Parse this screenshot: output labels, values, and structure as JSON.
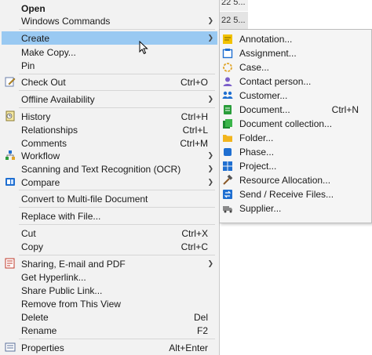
{
  "background": {
    "top_snippet": "22 5...",
    "row_snippet": "22 5..."
  },
  "menu": {
    "items": [
      {
        "label": "Open",
        "shortcut": "",
        "submenu": false
      },
      {
        "label": "Windows Commands",
        "shortcut": "",
        "submenu": true
      },
      {
        "label": "Create",
        "shortcut": "",
        "submenu": true
      },
      {
        "label": "Make Copy...",
        "shortcut": "",
        "submenu": false
      },
      {
        "label": "Pin",
        "shortcut": "",
        "submenu": false
      },
      {
        "label": "Check Out",
        "shortcut": "Ctrl+O",
        "submenu": false
      },
      {
        "label": "Offline Availability",
        "shortcut": "",
        "submenu": true
      },
      {
        "label": "History",
        "shortcut": "Ctrl+H",
        "submenu": false
      },
      {
        "label": "Relationships",
        "shortcut": "Ctrl+L",
        "submenu": false
      },
      {
        "label": "Comments",
        "shortcut": "Ctrl+M",
        "submenu": false
      },
      {
        "label": "Workflow",
        "shortcut": "",
        "submenu": true
      },
      {
        "label": "Scanning and Text Recognition (OCR)",
        "shortcut": "",
        "submenu": true
      },
      {
        "label": "Compare",
        "shortcut": "",
        "submenu": true
      },
      {
        "label": "Convert to Multi-file Document",
        "shortcut": "",
        "submenu": false
      },
      {
        "label": "Replace with File...",
        "shortcut": "",
        "submenu": false
      },
      {
        "label": "Cut",
        "shortcut": "Ctrl+X",
        "submenu": false
      },
      {
        "label": "Copy",
        "shortcut": "Ctrl+C",
        "submenu": false
      },
      {
        "label": "Sharing, E-mail and PDF",
        "shortcut": "",
        "submenu": true
      },
      {
        "label": "Get Hyperlink...",
        "shortcut": "",
        "submenu": false
      },
      {
        "label": "Share Public Link...",
        "shortcut": "",
        "submenu": false
      },
      {
        "label": "Remove from This View",
        "shortcut": "",
        "submenu": false
      },
      {
        "label": "Delete",
        "shortcut": "Del",
        "submenu": false
      },
      {
        "label": "Rename",
        "shortcut": "F2",
        "submenu": false
      },
      {
        "label": "Properties",
        "shortcut": "Alt+Enter",
        "submenu": false
      }
    ]
  },
  "submenu": {
    "items": [
      {
        "label": "Annotation...",
        "shortcut": ""
      },
      {
        "label": "Assignment...",
        "shortcut": ""
      },
      {
        "label": "Case...",
        "shortcut": ""
      },
      {
        "label": "Contact person...",
        "shortcut": ""
      },
      {
        "label": "Customer...",
        "shortcut": ""
      },
      {
        "label": "Document...",
        "shortcut": "Ctrl+N"
      },
      {
        "label": "Document collection...",
        "shortcut": ""
      },
      {
        "label": "Folder...",
        "shortcut": ""
      },
      {
        "label": "Phase...",
        "shortcut": ""
      },
      {
        "label": "Project...",
        "shortcut": ""
      },
      {
        "label": "Resource Allocation...",
        "shortcut": ""
      },
      {
        "label": "Send / Receive Files...",
        "shortcut": ""
      },
      {
        "label": "Supplier...",
        "shortcut": ""
      }
    ]
  },
  "colors": {
    "highlight": "#99c9f2",
    "menu_bg": "#f2f2f2",
    "accent_blue": "#1f6fd1"
  },
  "icons": {
    "check_out": "pencil-icon",
    "history": "history-icon",
    "workflow": "workflow-icon",
    "compare": "compare-icon",
    "sharing": "pdf-share-icon",
    "properties": "properties-icon",
    "annotation": "note-icon",
    "assignment": "assignment-icon",
    "case": "case-icon",
    "contact": "person-icon",
    "customer": "group-icon",
    "document": "document-icon",
    "collection": "collection-icon",
    "folder": "folder-icon",
    "phase": "phase-icon",
    "project": "project-icon",
    "resource": "hammer-icon",
    "send_receive": "send-receive-icon",
    "supplier": "truck-icon"
  }
}
